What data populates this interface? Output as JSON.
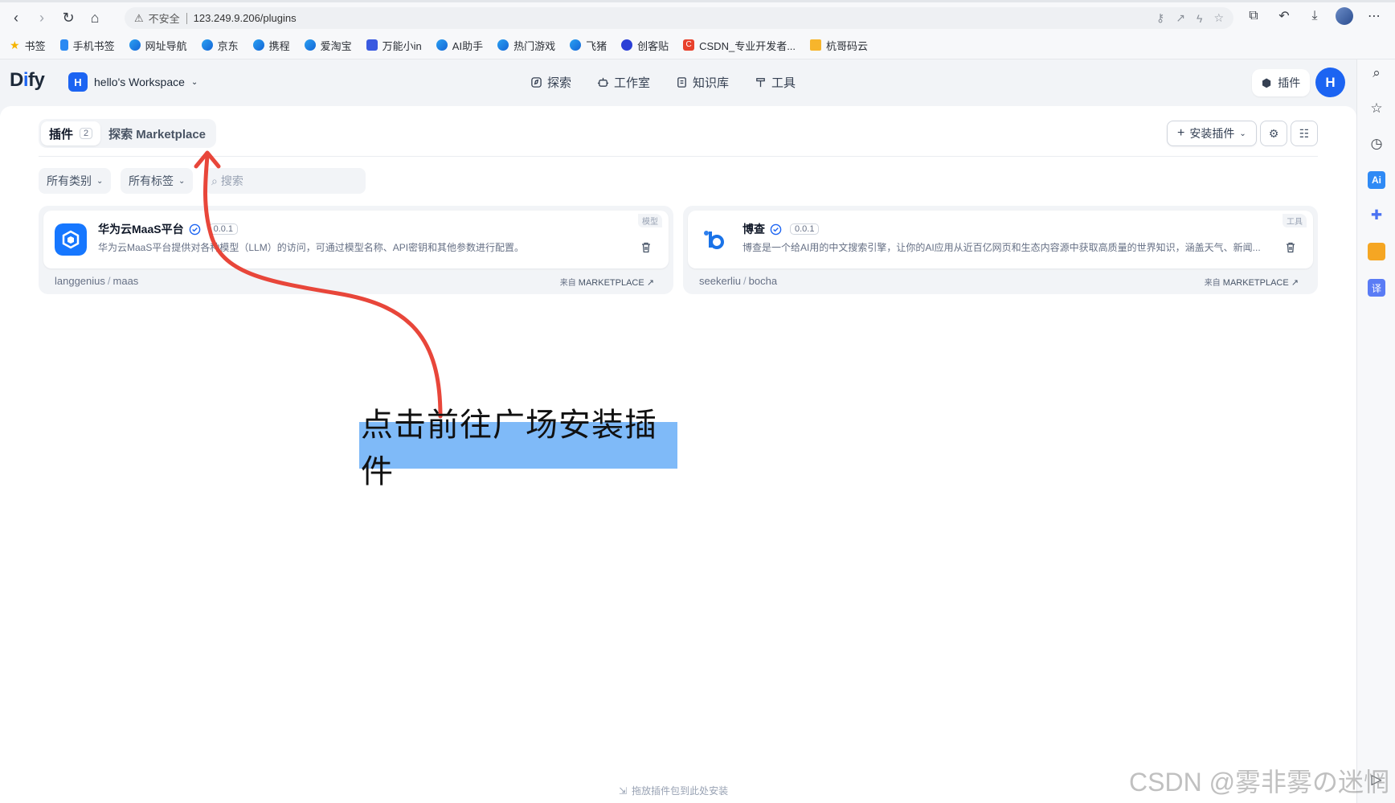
{
  "browser": {
    "insecure_label": "不安全",
    "url": "123.249.9.206/plugins",
    "bookmarks": [
      {
        "label": "书签",
        "icon": "star-icon"
      },
      {
        "label": "手机书签",
        "icon": "phone-bookmark-icon"
      },
      {
        "label": "网址导航",
        "icon": "nav-icon"
      },
      {
        "label": "京东",
        "icon": "site-icon"
      },
      {
        "label": "携程",
        "icon": "site-icon"
      },
      {
        "label": "爱淘宝",
        "icon": "site-icon"
      },
      {
        "label": "万能小in",
        "icon": "robot-icon"
      },
      {
        "label": "AI助手",
        "icon": "site-icon"
      },
      {
        "label": "热门游戏",
        "icon": "site-icon"
      },
      {
        "label": "飞猪",
        "icon": "site-icon"
      },
      {
        "label": "创客贴",
        "icon": "site-icon"
      },
      {
        "label": "CSDN_专业开发者...",
        "icon": "csdn-icon"
      },
      {
        "label": "杭哥码云",
        "icon": "folder-icon"
      }
    ]
  },
  "app": {
    "logo_prefix": "D",
    "logo_accent": "i",
    "logo_suffix": "fy",
    "workspace_initial": "H",
    "workspace_name": "hello's Workspace",
    "nav": [
      {
        "label": "探索"
      },
      {
        "label": "工作室"
      },
      {
        "label": "知识库"
      },
      {
        "label": "工具"
      }
    ],
    "plugins_button": "插件",
    "user_initial": "H",
    "accent_color": "#1c64f2"
  },
  "plugins_page": {
    "tabs": [
      {
        "label": "插件",
        "count": "2"
      },
      {
        "label": "探索 Marketplace"
      }
    ],
    "install_button": "安装插件",
    "filters": {
      "category": "所有类别",
      "tags": "所有标签",
      "search_placeholder": "搜索"
    },
    "cards": [
      {
        "title": "华为云MaaS平台",
        "version": "0.0.1",
        "type_tag": "模型",
        "description": "华为云MaaS平台提供对各种模型（LLM）的访问，可通过模型名称、API密钥和其他参数进行配置。",
        "org": "langgenius",
        "name": "maas",
        "source_prefix": "来自",
        "source": "MARKETPLACE"
      },
      {
        "title": "博查",
        "version": "0.0.1",
        "type_tag": "工具",
        "description": "博查是一个给AI用的中文搜索引擎，让你的AI应用从近百亿网页和生态内容源中获取高质量的世界知识，涵盖天气、新闻...",
        "org": "seekerliu",
        "name": "bocha",
        "source_prefix": "来自",
        "source": "MARKETPLACE"
      }
    ],
    "drop_hint": "拖放插件包到此处安装"
  },
  "annotation": {
    "label": "点击前往广场安装插件",
    "arrow_color": "#e8463a",
    "highlight_color": "#7fbaf8"
  },
  "watermark": "CSDN @雾非雾の迷惘"
}
